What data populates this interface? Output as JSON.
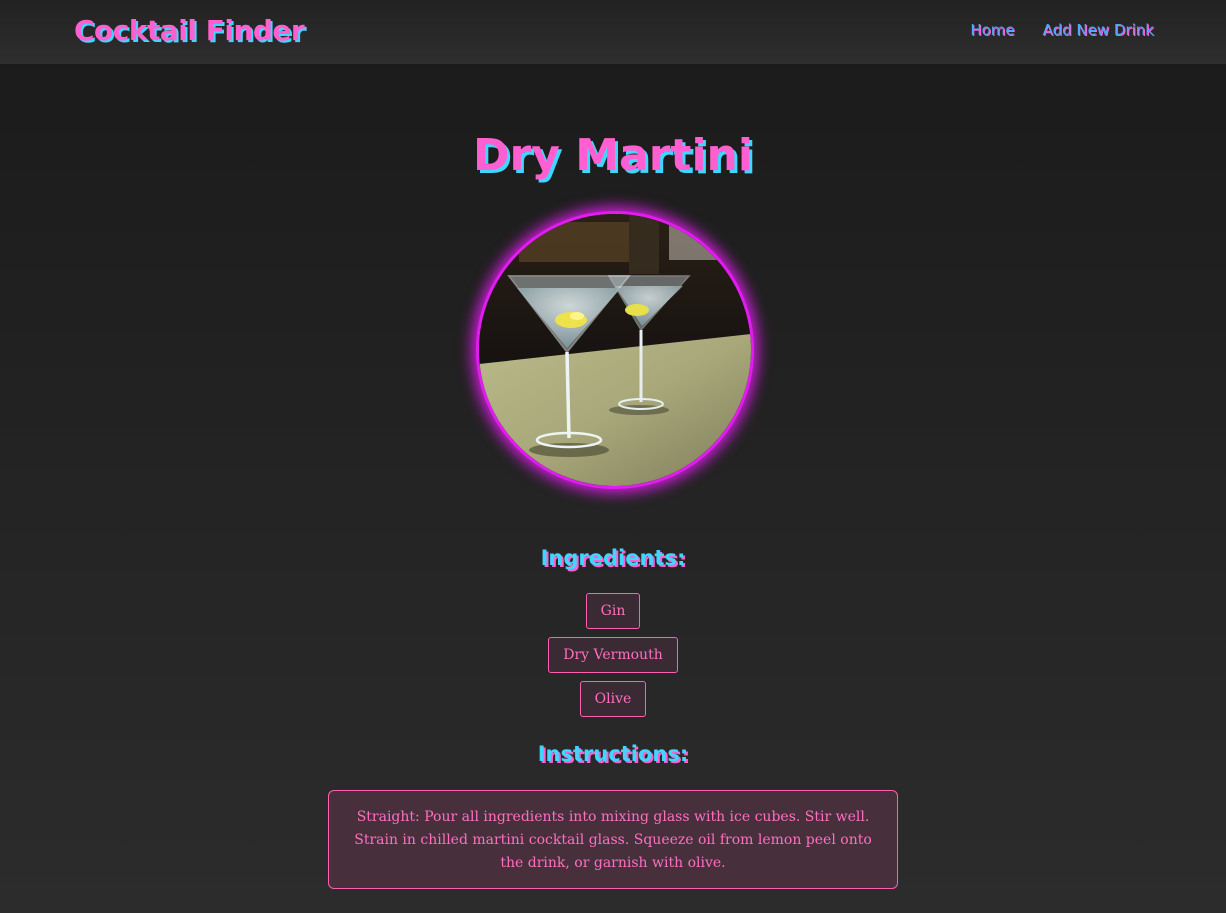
{
  "nav": {
    "brand": "Cocktail Finder",
    "links": [
      {
        "label": "Home"
      },
      {
        "label": "Add New Drink"
      }
    ]
  },
  "drink": {
    "name": "Dry Martini",
    "photo_icon": "martini-glasses-photo",
    "ingredients_heading": "Ingredients:",
    "ingredients": [
      "Gin",
      "Dry Vermouth",
      "Olive"
    ],
    "instructions_heading": "Instructions:",
    "instructions": "Straight: Pour all ingredients into mixing glass with ice cubes. Stir well. Strain in chilled martini cocktail glass. Squeeze oil from lemon peel onto the drink, or garnish with olive."
  },
  "colors": {
    "accent_pink": "#ff5fd0",
    "accent_cyan": "#3fd6ff",
    "link_blue": "#4ea7ff",
    "photo_border": "#e21cf0"
  }
}
